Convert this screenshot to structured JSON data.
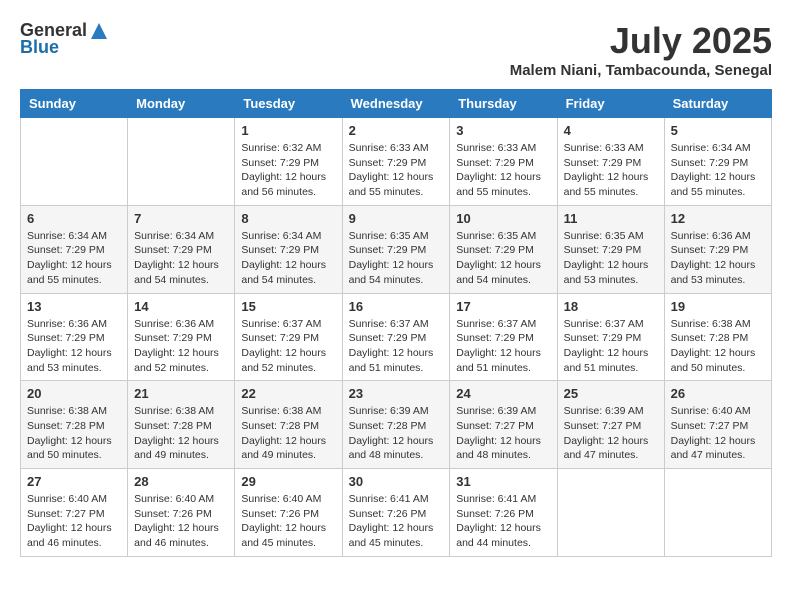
{
  "header": {
    "logo_general": "General",
    "logo_blue": "Blue",
    "month_year": "July 2025",
    "location": "Malem Niani, Tambacounda, Senegal"
  },
  "days_of_week": [
    "Sunday",
    "Monday",
    "Tuesday",
    "Wednesday",
    "Thursday",
    "Friday",
    "Saturday"
  ],
  "weeks": [
    [
      {
        "day": "",
        "info": ""
      },
      {
        "day": "",
        "info": ""
      },
      {
        "day": "1",
        "info": "Sunrise: 6:32 AM\nSunset: 7:29 PM\nDaylight: 12 hours and 56 minutes."
      },
      {
        "day": "2",
        "info": "Sunrise: 6:33 AM\nSunset: 7:29 PM\nDaylight: 12 hours and 55 minutes."
      },
      {
        "day": "3",
        "info": "Sunrise: 6:33 AM\nSunset: 7:29 PM\nDaylight: 12 hours and 55 minutes."
      },
      {
        "day": "4",
        "info": "Sunrise: 6:33 AM\nSunset: 7:29 PM\nDaylight: 12 hours and 55 minutes."
      },
      {
        "day": "5",
        "info": "Sunrise: 6:34 AM\nSunset: 7:29 PM\nDaylight: 12 hours and 55 minutes."
      }
    ],
    [
      {
        "day": "6",
        "info": "Sunrise: 6:34 AM\nSunset: 7:29 PM\nDaylight: 12 hours and 55 minutes."
      },
      {
        "day": "7",
        "info": "Sunrise: 6:34 AM\nSunset: 7:29 PM\nDaylight: 12 hours and 54 minutes."
      },
      {
        "day": "8",
        "info": "Sunrise: 6:34 AM\nSunset: 7:29 PM\nDaylight: 12 hours and 54 minutes."
      },
      {
        "day": "9",
        "info": "Sunrise: 6:35 AM\nSunset: 7:29 PM\nDaylight: 12 hours and 54 minutes."
      },
      {
        "day": "10",
        "info": "Sunrise: 6:35 AM\nSunset: 7:29 PM\nDaylight: 12 hours and 54 minutes."
      },
      {
        "day": "11",
        "info": "Sunrise: 6:35 AM\nSunset: 7:29 PM\nDaylight: 12 hours and 53 minutes."
      },
      {
        "day": "12",
        "info": "Sunrise: 6:36 AM\nSunset: 7:29 PM\nDaylight: 12 hours and 53 minutes."
      }
    ],
    [
      {
        "day": "13",
        "info": "Sunrise: 6:36 AM\nSunset: 7:29 PM\nDaylight: 12 hours and 53 minutes."
      },
      {
        "day": "14",
        "info": "Sunrise: 6:36 AM\nSunset: 7:29 PM\nDaylight: 12 hours and 52 minutes."
      },
      {
        "day": "15",
        "info": "Sunrise: 6:37 AM\nSunset: 7:29 PM\nDaylight: 12 hours and 52 minutes."
      },
      {
        "day": "16",
        "info": "Sunrise: 6:37 AM\nSunset: 7:29 PM\nDaylight: 12 hours and 51 minutes."
      },
      {
        "day": "17",
        "info": "Sunrise: 6:37 AM\nSunset: 7:29 PM\nDaylight: 12 hours and 51 minutes."
      },
      {
        "day": "18",
        "info": "Sunrise: 6:37 AM\nSunset: 7:29 PM\nDaylight: 12 hours and 51 minutes."
      },
      {
        "day": "19",
        "info": "Sunrise: 6:38 AM\nSunset: 7:28 PM\nDaylight: 12 hours and 50 minutes."
      }
    ],
    [
      {
        "day": "20",
        "info": "Sunrise: 6:38 AM\nSunset: 7:28 PM\nDaylight: 12 hours and 50 minutes."
      },
      {
        "day": "21",
        "info": "Sunrise: 6:38 AM\nSunset: 7:28 PM\nDaylight: 12 hours and 49 minutes."
      },
      {
        "day": "22",
        "info": "Sunrise: 6:38 AM\nSunset: 7:28 PM\nDaylight: 12 hours and 49 minutes."
      },
      {
        "day": "23",
        "info": "Sunrise: 6:39 AM\nSunset: 7:28 PM\nDaylight: 12 hours and 48 minutes."
      },
      {
        "day": "24",
        "info": "Sunrise: 6:39 AM\nSunset: 7:27 PM\nDaylight: 12 hours and 48 minutes."
      },
      {
        "day": "25",
        "info": "Sunrise: 6:39 AM\nSunset: 7:27 PM\nDaylight: 12 hours and 47 minutes."
      },
      {
        "day": "26",
        "info": "Sunrise: 6:40 AM\nSunset: 7:27 PM\nDaylight: 12 hours and 47 minutes."
      }
    ],
    [
      {
        "day": "27",
        "info": "Sunrise: 6:40 AM\nSunset: 7:27 PM\nDaylight: 12 hours and 46 minutes."
      },
      {
        "day": "28",
        "info": "Sunrise: 6:40 AM\nSunset: 7:26 PM\nDaylight: 12 hours and 46 minutes."
      },
      {
        "day": "29",
        "info": "Sunrise: 6:40 AM\nSunset: 7:26 PM\nDaylight: 12 hours and 45 minutes."
      },
      {
        "day": "30",
        "info": "Sunrise: 6:41 AM\nSunset: 7:26 PM\nDaylight: 12 hours and 45 minutes."
      },
      {
        "day": "31",
        "info": "Sunrise: 6:41 AM\nSunset: 7:26 PM\nDaylight: 12 hours and 44 minutes."
      },
      {
        "day": "",
        "info": ""
      },
      {
        "day": "",
        "info": ""
      }
    ]
  ]
}
